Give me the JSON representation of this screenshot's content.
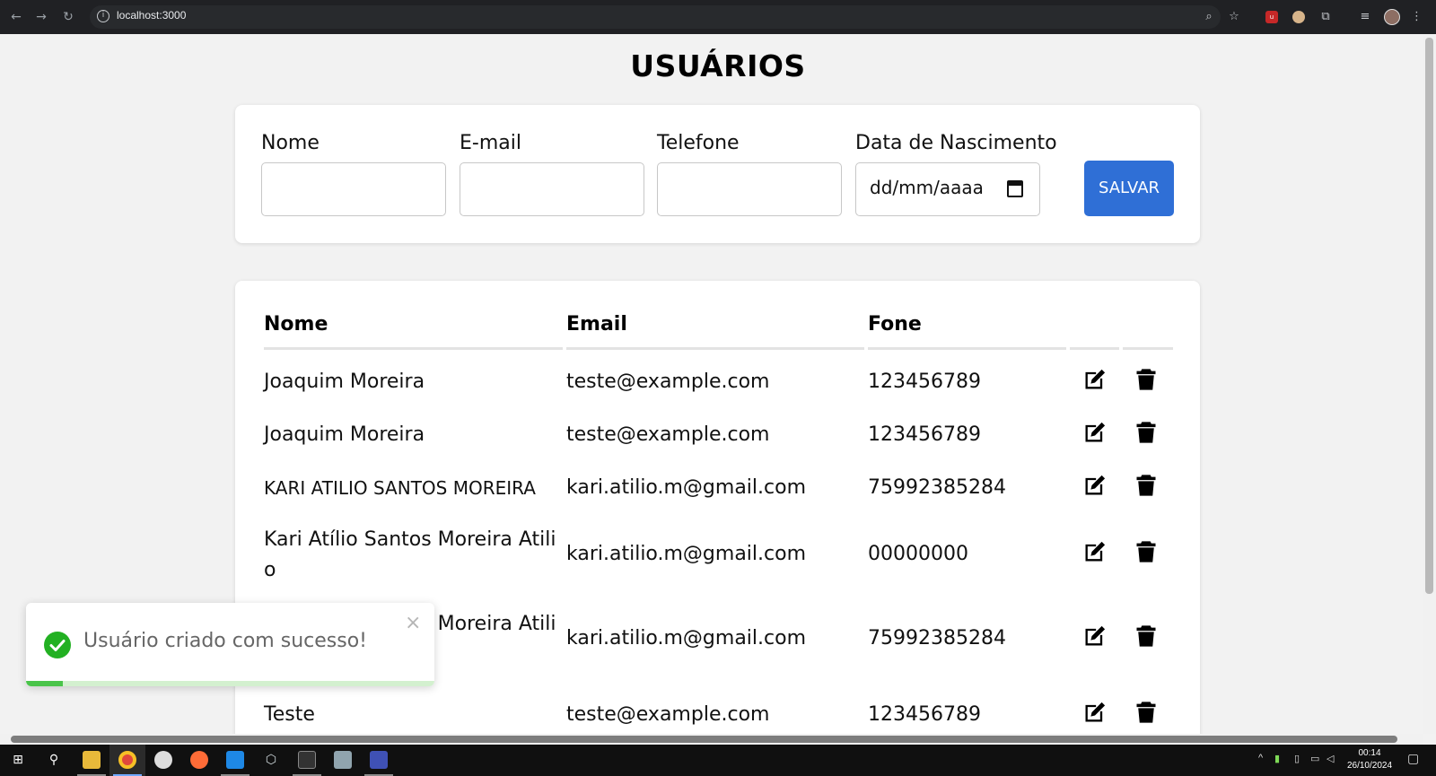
{
  "browser": {
    "url": "localhost:3000"
  },
  "page": {
    "title": "USUÁRIOS"
  },
  "form": {
    "fields": [
      {
        "label": "Nome",
        "value": ""
      },
      {
        "label": "E-mail",
        "value": ""
      },
      {
        "label": "Telefone",
        "value": ""
      },
      {
        "label": "Data de Nascimento",
        "value": "dd/mm/aaaa"
      }
    ],
    "save_label": "SALVAR"
  },
  "table": {
    "headers": [
      "Nome",
      "Email",
      "Fone"
    ],
    "rows": [
      {
        "nome": "Joaquim Moreira",
        "email": "teste@example.com",
        "fone": "123456789"
      },
      {
        "nome": "Joaquim Moreira",
        "email": "teste@example.com",
        "fone": "123456789"
      },
      {
        "nome": "KARI ATILIO SANTOS MOREIRA",
        "email": "kari.atilio.m@gmail.com",
        "fone": "75992385284"
      },
      {
        "nome": "Kari Atílio Santos Moreira Atilio",
        "email": "kari.atilio.m@gmail.com",
        "fone": "00000000"
      },
      {
        "nome": "Kari Atílio Santos Moreira Atilio",
        "email": "kari.atilio.m@gmail.com",
        "fone": "75992385284"
      },
      {
        "nome": "Teste",
        "email": "teste@example.com",
        "fone": "123456789"
      }
    ]
  },
  "toast": {
    "message": "Usuário criado com sucesso!",
    "close_glyph": "×",
    "progress": 0.09
  },
  "taskbar": {
    "time": "00:14",
    "date": "26/10/2024"
  },
  "colors": {
    "primary_button": "#2f6fd6",
    "success": "#22b022",
    "page_bg": "#f2f2f2"
  }
}
